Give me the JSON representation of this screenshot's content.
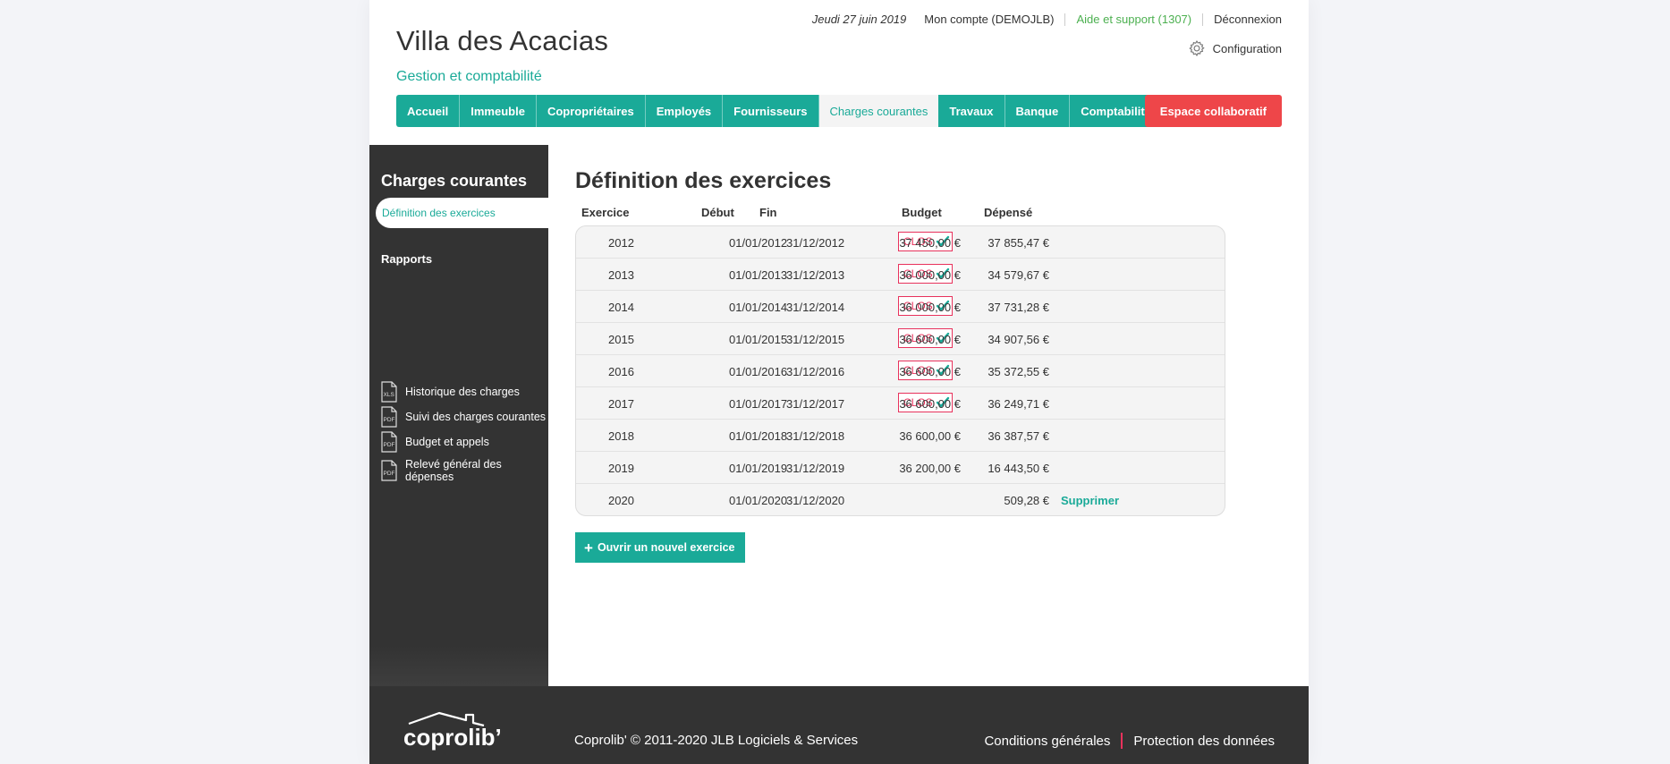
{
  "header": {
    "title": "Villa des Acacias",
    "subtitle": "Gestion et comptabilité",
    "date": "Jeudi 27 juin 2019",
    "account": "Mon compte (DEMOJLB)",
    "support": "Aide et support (1307)",
    "logout": "Déconnexion",
    "config": "Configuration",
    "collab": "Espace collaboratif"
  },
  "nav": [
    {
      "label": "Accueil"
    },
    {
      "label": "Immeuble"
    },
    {
      "label": "Copropriétaires"
    },
    {
      "label": "Employés"
    },
    {
      "label": "Fournisseurs"
    },
    {
      "label": "Charges courantes",
      "active": true
    },
    {
      "label": "Travaux"
    },
    {
      "label": "Banque"
    },
    {
      "label": "Comptabilité"
    }
  ],
  "sidebar": {
    "title": "Charges courantes",
    "active_item": "Définition des exercices",
    "section": "Rapports",
    "reports": [
      {
        "label": "Historique des charges",
        "type": "XLS"
      },
      {
        "label": "Suivi des charges courantes",
        "type": "PDF"
      },
      {
        "label": "Budget et appels",
        "type": "PDF"
      },
      {
        "label": "Relevé général des dépenses",
        "type": "PDF"
      }
    ]
  },
  "main": {
    "title": "Définition des exercices",
    "columns": {
      "exercice": "Exercice",
      "debut": "Début",
      "fin": "Fin",
      "budget": "Budget",
      "depense": "Dépensé"
    },
    "closed_label": "CLOS",
    "delete_label": "Supprimer",
    "new_button": "Ouvrir un nouvel exercice",
    "rows": [
      {
        "year": "2012",
        "start": "01/01/2012",
        "end": "31/12/2012",
        "closed": true,
        "budget": "37 450,00 €",
        "spent": "37 855,47 €"
      },
      {
        "year": "2013",
        "start": "01/01/2013",
        "end": "31/12/2013",
        "closed": true,
        "budget": "36 000,00 €",
        "spent": "34 579,67 €"
      },
      {
        "year": "2014",
        "start": "01/01/2014",
        "end": "31/12/2014",
        "closed": true,
        "budget": "36 000,00 €",
        "spent": "37 731,28 €"
      },
      {
        "year": "2015",
        "start": "01/01/2015",
        "end": "31/12/2015",
        "closed": true,
        "budget": "36 600,00 €",
        "spent": "34 907,56 €"
      },
      {
        "year": "2016",
        "start": "01/01/2016",
        "end": "31/12/2016",
        "closed": true,
        "budget": "36 600,00 €",
        "spent": "35 372,55 €"
      },
      {
        "year": "2017",
        "start": "01/01/2017",
        "end": "31/12/2017",
        "closed": true,
        "budget": "36 600,00 €",
        "spent": "36 249,71 €"
      },
      {
        "year": "2018",
        "start": "01/01/2018",
        "end": "31/12/2018",
        "closed": false,
        "budget": "36 600,00 €",
        "spent": "36 387,57 €"
      },
      {
        "year": "2019",
        "start": "01/01/2019",
        "end": "31/12/2019",
        "closed": false,
        "budget": "36 200,00 €",
        "spent": "16 443,50 €"
      },
      {
        "year": "2020",
        "start": "01/01/2020",
        "end": "31/12/2020",
        "closed": false,
        "budget": "",
        "spent": "509,28 €",
        "deletable": true
      }
    ]
  },
  "footer": {
    "logo_text": "coprolib’",
    "copyright": "Coprolib' © 2011-2020 JLB Logiciels & Services",
    "terms": "Conditions générales",
    "privacy": "Protection des données"
  },
  "colors": {
    "accent": "#1aaa98",
    "danger": "#ee4649",
    "closed": "#e8325c",
    "support": "#4cb050"
  }
}
